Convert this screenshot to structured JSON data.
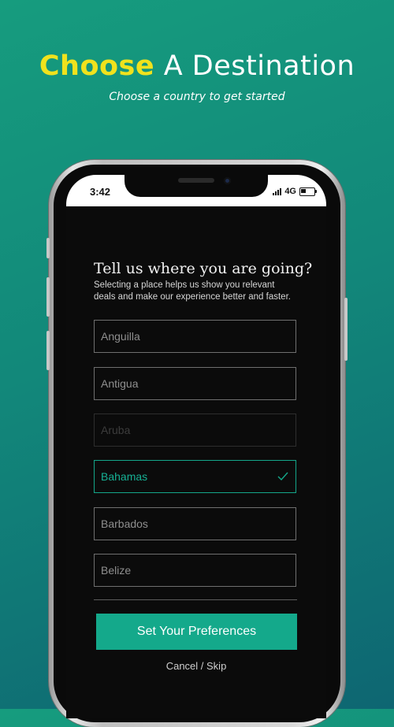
{
  "hero": {
    "title_highlight": "Choose",
    "title_rest": " A Destination",
    "subtitle": "Choose a country to get started"
  },
  "status_bar": {
    "time": "3:42",
    "network": "4G"
  },
  "question": {
    "title": "Tell us where you are going?",
    "description": "Selecting a place helps us show you relevant deals and make our experience better and faster."
  },
  "options": [
    {
      "label": "Anguilla",
      "state": "normal"
    },
    {
      "label": "Antigua",
      "state": "normal"
    },
    {
      "label": "Aruba",
      "state": "dim"
    },
    {
      "label": "Bahamas",
      "state": "selected"
    },
    {
      "label": "Barbados",
      "state": "normal"
    },
    {
      "label": "Belize",
      "state": "normal"
    }
  ],
  "actions": {
    "primary_label": "Set Your Preferences",
    "secondary_label": "Cancel / Skip"
  },
  "colors": {
    "accent": "#14a98b",
    "highlight": "#f0e21d"
  },
  "icons": {
    "selected_indicator": "check-icon",
    "signal": "signal-icon",
    "battery": "battery-icon"
  }
}
